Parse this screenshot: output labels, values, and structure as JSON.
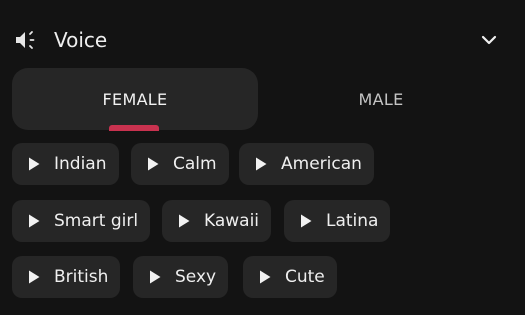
{
  "header": {
    "title": "Voice",
    "speaker_icon": "speaker-icon",
    "toggle_icon": "chevron-down-icon"
  },
  "tabs": [
    {
      "label": "FEMALE",
      "selected": true
    },
    {
      "label": "MALE",
      "selected": false
    }
  ],
  "accent_color": "#c8324f",
  "voice_icon": "play-icon",
  "voices": [
    "Indian",
    "Calm",
    "American",
    "Smart girl",
    "Kawaii",
    "Latina",
    "British",
    "Sexy",
    "Cute"
  ]
}
